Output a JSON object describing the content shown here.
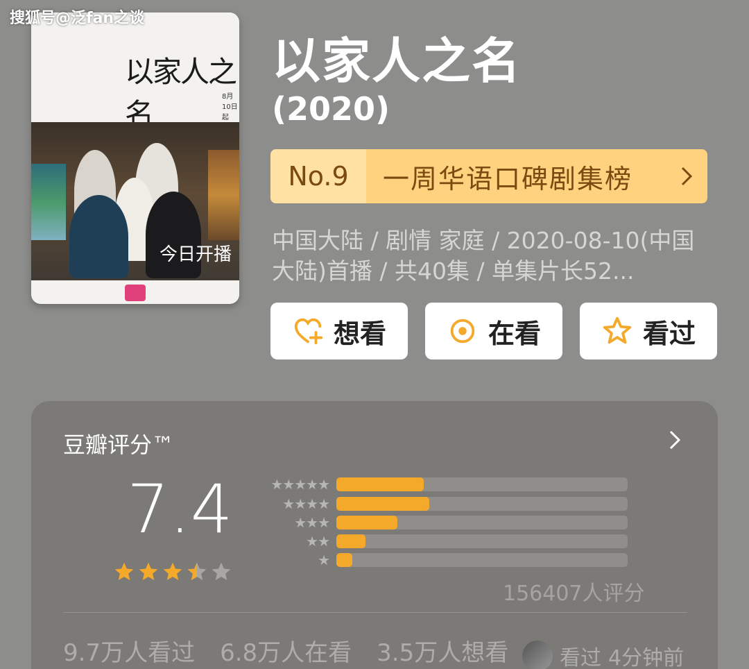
{
  "watermark": "搜狐号@泛fan之谈",
  "poster": {
    "calligraphy": "以家人之名",
    "date": "8月10日起",
    "tagline": "今日开播"
  },
  "title": "以家人之名",
  "year": "(2020)",
  "rank": {
    "no": "No.9",
    "label": "一周华语口碑剧集榜"
  },
  "meta_line": "中国大陆 / 剧情 家庭 / 2020-08-10(中国大陆)首播 / 共40集 / 单集片长52...",
  "actions": {
    "want": "想看",
    "watching": "在看",
    "watched": "看过"
  },
  "rating": {
    "title": "豆瓣评分™",
    "score": "7.4",
    "stars": 3.5,
    "distribution": [
      {
        "label": "★★★★★",
        "fraction": 0.3
      },
      {
        "label": "★★★★",
        "fraction": 0.32
      },
      {
        "label": "★★★",
        "fraction": 0.21
      },
      {
        "label": "★★",
        "fraction": 0.1
      },
      {
        "label": "★",
        "fraction": 0.055
      }
    ],
    "vote_count": "156407人评分"
  },
  "stats": {
    "watched": "9.7万人看过",
    "watching": "6.8万人在看",
    "want": "3.5万人想看"
  },
  "recent": {
    "status": "看过",
    "time": "4分钟前"
  },
  "colors": {
    "accent": "#f4a92a",
    "rank_bg": "#ffd27f",
    "rank_text": "#7a4a10",
    "card_bg": "#7b7a77"
  }
}
